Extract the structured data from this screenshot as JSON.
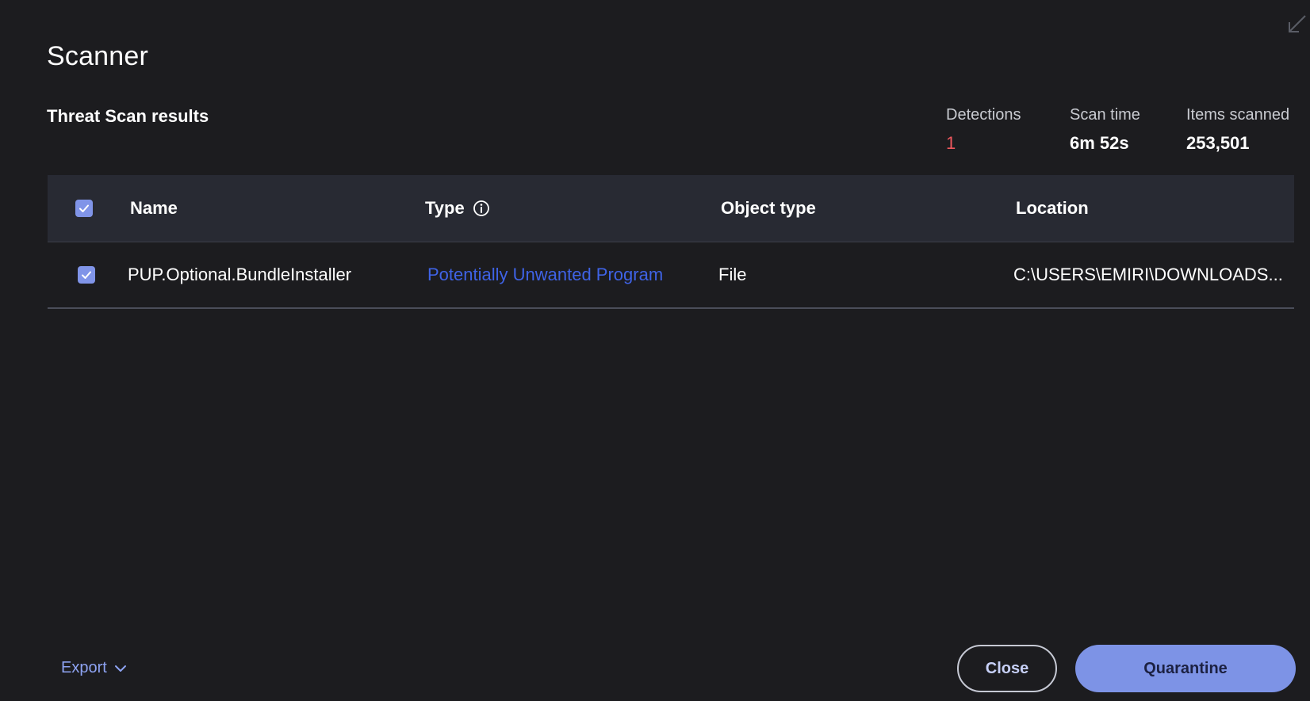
{
  "window": {
    "title": "Scanner",
    "collapse_icon": "collapse-arrow-icon"
  },
  "results": {
    "title": "Threat Scan results"
  },
  "stats": {
    "detections_label": "Detections",
    "detections_value": "1",
    "scan_time_label": "Scan time",
    "scan_time_value": "6m 52s",
    "items_label": "Items scanned",
    "items_value": "253,501"
  },
  "table": {
    "columns": {
      "name": "Name",
      "type": "Type",
      "object_type": "Object type",
      "location": "Location"
    },
    "header_checked": true,
    "rows": [
      {
        "checked": true,
        "name": "PUP.Optional.BundleInstaller",
        "type": "Potentially Unwanted Program",
        "object_type": "File",
        "location": "C:\\USERS\\EMIRI\\DOWNLOADS..."
      }
    ]
  },
  "footer": {
    "export_label": "Export",
    "close_label": "Close",
    "quarantine_label": "Quarantine"
  },
  "colors": {
    "background": "#1c1c1f",
    "header_bg": "#282a33",
    "accent": "#7d93e6",
    "link": "#3f63e6",
    "alert": "#f0585e"
  }
}
